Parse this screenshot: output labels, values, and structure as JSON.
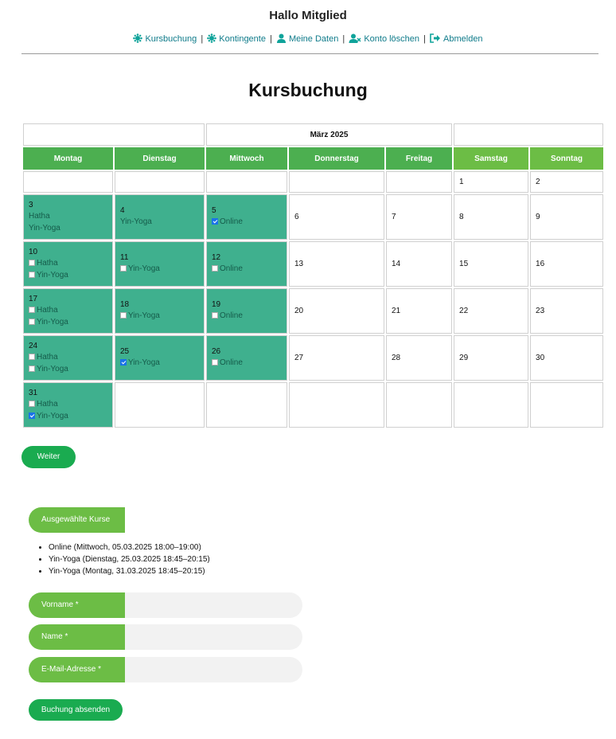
{
  "header": {
    "greeting": "Hallo Mitglied",
    "nav": [
      {
        "label": "Kursbuchung",
        "icon": "gear-flower-icon"
      },
      {
        "label": "Kontingente",
        "icon": "gear-flower-icon"
      },
      {
        "label": "Meine Daten",
        "icon": "user-icon"
      },
      {
        "label": "Konto löschen",
        "icon": "user-remove-icon"
      },
      {
        "label": "Abmelden",
        "icon": "logout-icon"
      }
    ],
    "separator": "|"
  },
  "page_title": "Kursbuchung",
  "calendar": {
    "month": "März 2025",
    "weekdays": [
      "Montag",
      "Dienstag",
      "Mittwoch",
      "Donnerstag",
      "Freitag",
      "Samstag",
      "Sonntag"
    ],
    "weeks": [
      [
        null,
        null,
        null,
        null,
        null,
        {
          "day": "1"
        },
        {
          "day": "2"
        }
      ],
      [
        {
          "day": "3",
          "courses": [
            {
              "name": "Hatha",
              "checkbox": false
            },
            {
              "name": "Yin-Yoga",
              "checkbox": false
            }
          ]
        },
        {
          "day": "4",
          "courses": [
            {
              "name": "Yin-Yoga",
              "checkbox": false
            }
          ]
        },
        {
          "day": "5",
          "courses": [
            {
              "name": "Online",
              "checkbox": true,
              "checked": true
            }
          ]
        },
        {
          "day": "6"
        },
        {
          "day": "7"
        },
        {
          "day": "8"
        },
        {
          "day": "9"
        }
      ],
      [
        {
          "day": "10",
          "courses": [
            {
              "name": "Hatha",
              "checkbox": true,
              "checked": false
            },
            {
              "name": "Yin-Yoga",
              "checkbox": true,
              "checked": false
            }
          ]
        },
        {
          "day": "11",
          "courses": [
            {
              "name": "Yin-Yoga",
              "checkbox": true,
              "checked": false
            }
          ]
        },
        {
          "day": "12",
          "courses": [
            {
              "name": "Online",
              "checkbox": true,
              "checked": false
            }
          ]
        },
        {
          "day": "13"
        },
        {
          "day": "14"
        },
        {
          "day": "15"
        },
        {
          "day": "16"
        }
      ],
      [
        {
          "day": "17",
          "courses": [
            {
              "name": "Hatha",
              "checkbox": true,
              "checked": false
            },
            {
              "name": "Yin-Yoga",
              "checkbox": true,
              "checked": false
            }
          ]
        },
        {
          "day": "18",
          "courses": [
            {
              "name": "Yin-Yoga",
              "checkbox": true,
              "checked": false
            }
          ]
        },
        {
          "day": "19",
          "courses": [
            {
              "name": "Online",
              "checkbox": true,
              "checked": false
            }
          ]
        },
        {
          "day": "20"
        },
        {
          "day": "21"
        },
        {
          "day": "22"
        },
        {
          "day": "23"
        }
      ],
      [
        {
          "day": "24",
          "courses": [
            {
              "name": "Hatha",
              "checkbox": true,
              "checked": false
            },
            {
              "name": "Yin-Yoga",
              "checkbox": true,
              "checked": false
            }
          ]
        },
        {
          "day": "25",
          "courses": [
            {
              "name": "Yin-Yoga",
              "checkbox": true,
              "checked": true
            }
          ]
        },
        {
          "day": "26",
          "courses": [
            {
              "name": "Online",
              "checkbox": true,
              "checked": false
            }
          ]
        },
        {
          "day": "27"
        },
        {
          "day": "28"
        },
        {
          "day": "29"
        },
        {
          "day": "30"
        }
      ],
      [
        {
          "day": "31",
          "courses": [
            {
              "name": "Hatha",
              "checkbox": true,
              "checked": false
            },
            {
              "name": "Yin-Yoga",
              "checkbox": true,
              "checked": true
            }
          ]
        },
        null,
        null,
        null,
        null,
        null,
        null
      ]
    ]
  },
  "next_button": "Weiter",
  "selected": {
    "header": "Ausgewählte Kurse",
    "items": [
      "Online (Mittwoch, 05.03.2025 18:00–19:00)",
      "Yin-Yoga (Dienstag, 25.03.2025 18:45–20:15)",
      "Yin-Yoga (Montag, 31.03.2025 18:45–20:15)"
    ]
  },
  "form": {
    "firstname_label": "Vorname *",
    "firstname_value": "",
    "lastname_label": "Name *",
    "lastname_value": "",
    "email_label": "E-Mail-Adresse *",
    "email_value": "",
    "submit_label": "Buchung absenden"
  },
  "colors": {
    "weekday_header": "#4caf50",
    "weekend_header": "#6cbd45",
    "course_cell": "#3fb08e",
    "button": "#1aab50",
    "nav_link": "#0f7b8a"
  }
}
